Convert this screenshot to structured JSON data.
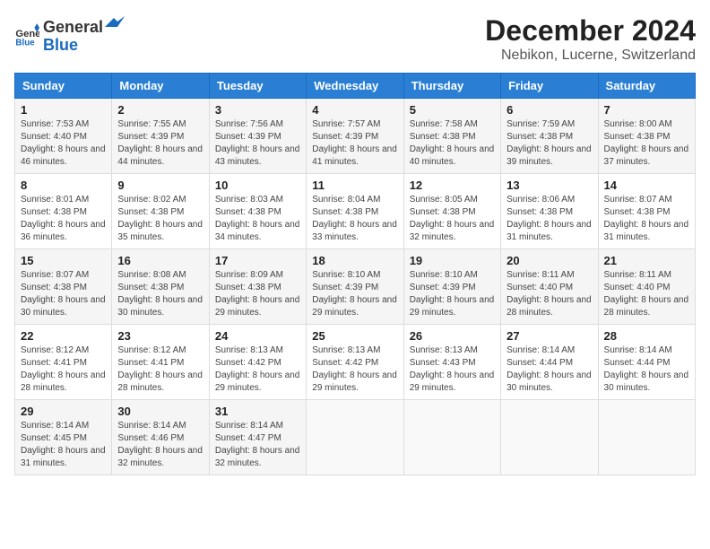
{
  "header": {
    "logo_general": "General",
    "logo_blue": "Blue",
    "month": "December 2024",
    "location": "Nebikon, Lucerne, Switzerland"
  },
  "weekdays": [
    "Sunday",
    "Monday",
    "Tuesday",
    "Wednesday",
    "Thursday",
    "Friday",
    "Saturday"
  ],
  "weeks": [
    [
      {
        "day": "1",
        "sunrise": "Sunrise: 7:53 AM",
        "sunset": "Sunset: 4:40 PM",
        "daylight": "Daylight: 8 hours and 46 minutes."
      },
      {
        "day": "2",
        "sunrise": "Sunrise: 7:55 AM",
        "sunset": "Sunset: 4:39 PM",
        "daylight": "Daylight: 8 hours and 44 minutes."
      },
      {
        "day": "3",
        "sunrise": "Sunrise: 7:56 AM",
        "sunset": "Sunset: 4:39 PM",
        "daylight": "Daylight: 8 hours and 43 minutes."
      },
      {
        "day": "4",
        "sunrise": "Sunrise: 7:57 AM",
        "sunset": "Sunset: 4:39 PM",
        "daylight": "Daylight: 8 hours and 41 minutes."
      },
      {
        "day": "5",
        "sunrise": "Sunrise: 7:58 AM",
        "sunset": "Sunset: 4:38 PM",
        "daylight": "Daylight: 8 hours and 40 minutes."
      },
      {
        "day": "6",
        "sunrise": "Sunrise: 7:59 AM",
        "sunset": "Sunset: 4:38 PM",
        "daylight": "Daylight: 8 hours and 39 minutes."
      },
      {
        "day": "7",
        "sunrise": "Sunrise: 8:00 AM",
        "sunset": "Sunset: 4:38 PM",
        "daylight": "Daylight: 8 hours and 37 minutes."
      }
    ],
    [
      {
        "day": "8",
        "sunrise": "Sunrise: 8:01 AM",
        "sunset": "Sunset: 4:38 PM",
        "daylight": "Daylight: 8 hours and 36 minutes."
      },
      {
        "day": "9",
        "sunrise": "Sunrise: 8:02 AM",
        "sunset": "Sunset: 4:38 PM",
        "daylight": "Daylight: 8 hours and 35 minutes."
      },
      {
        "day": "10",
        "sunrise": "Sunrise: 8:03 AM",
        "sunset": "Sunset: 4:38 PM",
        "daylight": "Daylight: 8 hours and 34 minutes."
      },
      {
        "day": "11",
        "sunrise": "Sunrise: 8:04 AM",
        "sunset": "Sunset: 4:38 PM",
        "daylight": "Daylight: 8 hours and 33 minutes."
      },
      {
        "day": "12",
        "sunrise": "Sunrise: 8:05 AM",
        "sunset": "Sunset: 4:38 PM",
        "daylight": "Daylight: 8 hours and 32 minutes."
      },
      {
        "day": "13",
        "sunrise": "Sunrise: 8:06 AM",
        "sunset": "Sunset: 4:38 PM",
        "daylight": "Daylight: 8 hours and 31 minutes."
      },
      {
        "day": "14",
        "sunrise": "Sunrise: 8:07 AM",
        "sunset": "Sunset: 4:38 PM",
        "daylight": "Daylight: 8 hours and 31 minutes."
      }
    ],
    [
      {
        "day": "15",
        "sunrise": "Sunrise: 8:07 AM",
        "sunset": "Sunset: 4:38 PM",
        "daylight": "Daylight: 8 hours and 30 minutes."
      },
      {
        "day": "16",
        "sunrise": "Sunrise: 8:08 AM",
        "sunset": "Sunset: 4:38 PM",
        "daylight": "Daylight: 8 hours and 30 minutes."
      },
      {
        "day": "17",
        "sunrise": "Sunrise: 8:09 AM",
        "sunset": "Sunset: 4:38 PM",
        "daylight": "Daylight: 8 hours and 29 minutes."
      },
      {
        "day": "18",
        "sunrise": "Sunrise: 8:10 AM",
        "sunset": "Sunset: 4:39 PM",
        "daylight": "Daylight: 8 hours and 29 minutes."
      },
      {
        "day": "19",
        "sunrise": "Sunrise: 8:10 AM",
        "sunset": "Sunset: 4:39 PM",
        "daylight": "Daylight: 8 hours and 29 minutes."
      },
      {
        "day": "20",
        "sunrise": "Sunrise: 8:11 AM",
        "sunset": "Sunset: 4:40 PM",
        "daylight": "Daylight: 8 hours and 28 minutes."
      },
      {
        "day": "21",
        "sunrise": "Sunrise: 8:11 AM",
        "sunset": "Sunset: 4:40 PM",
        "daylight": "Daylight: 8 hours and 28 minutes."
      }
    ],
    [
      {
        "day": "22",
        "sunrise": "Sunrise: 8:12 AM",
        "sunset": "Sunset: 4:41 PM",
        "daylight": "Daylight: 8 hours and 28 minutes."
      },
      {
        "day": "23",
        "sunrise": "Sunrise: 8:12 AM",
        "sunset": "Sunset: 4:41 PM",
        "daylight": "Daylight: 8 hours and 28 minutes."
      },
      {
        "day": "24",
        "sunrise": "Sunrise: 8:13 AM",
        "sunset": "Sunset: 4:42 PM",
        "daylight": "Daylight: 8 hours and 29 minutes."
      },
      {
        "day": "25",
        "sunrise": "Sunrise: 8:13 AM",
        "sunset": "Sunset: 4:42 PM",
        "daylight": "Daylight: 8 hours and 29 minutes."
      },
      {
        "day": "26",
        "sunrise": "Sunrise: 8:13 AM",
        "sunset": "Sunset: 4:43 PM",
        "daylight": "Daylight: 8 hours and 29 minutes."
      },
      {
        "day": "27",
        "sunrise": "Sunrise: 8:14 AM",
        "sunset": "Sunset: 4:44 PM",
        "daylight": "Daylight: 8 hours and 30 minutes."
      },
      {
        "day": "28",
        "sunrise": "Sunrise: 8:14 AM",
        "sunset": "Sunset: 4:44 PM",
        "daylight": "Daylight: 8 hours and 30 minutes."
      }
    ],
    [
      {
        "day": "29",
        "sunrise": "Sunrise: 8:14 AM",
        "sunset": "Sunset: 4:45 PM",
        "daylight": "Daylight: 8 hours and 31 minutes."
      },
      {
        "day": "30",
        "sunrise": "Sunrise: 8:14 AM",
        "sunset": "Sunset: 4:46 PM",
        "daylight": "Daylight: 8 hours and 32 minutes."
      },
      {
        "day": "31",
        "sunrise": "Sunrise: 8:14 AM",
        "sunset": "Sunset: 4:47 PM",
        "daylight": "Daylight: 8 hours and 32 minutes."
      },
      null,
      null,
      null,
      null
    ]
  ]
}
